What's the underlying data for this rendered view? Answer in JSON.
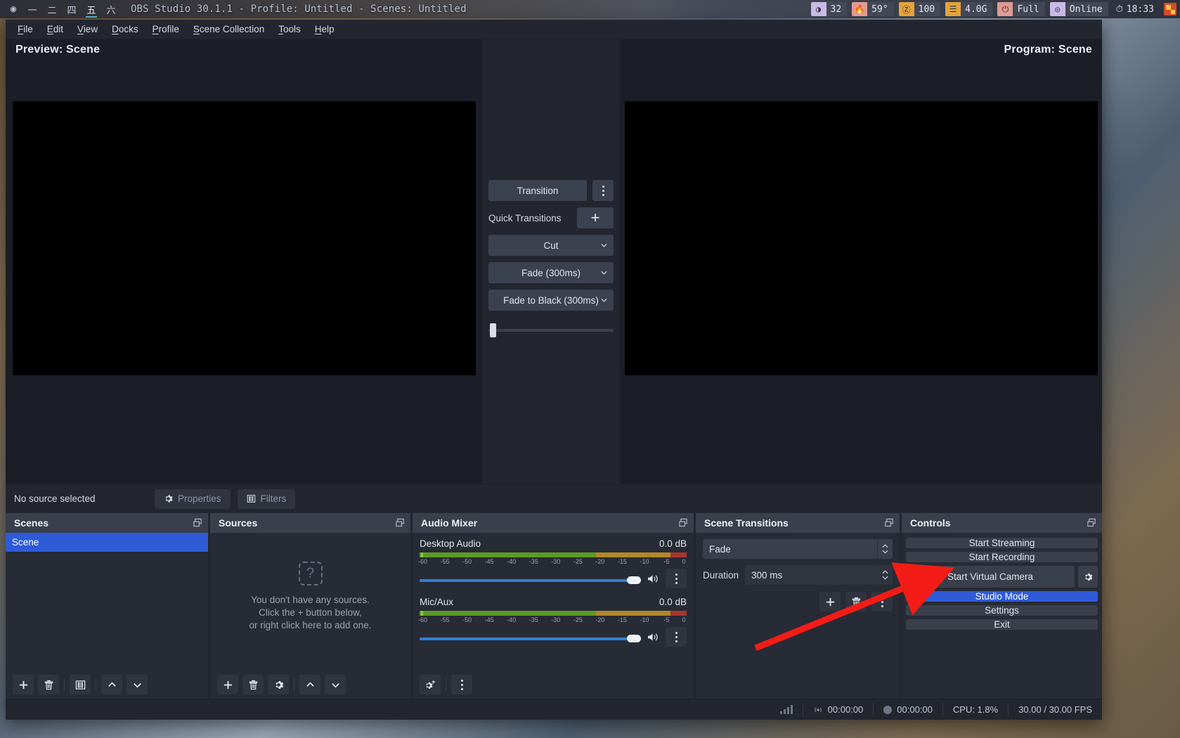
{
  "system_bar": {
    "app_icon": "obs-circle-icon",
    "workspaces": [
      {
        "label": "一",
        "active": false
      },
      {
        "label": "二",
        "active": false
      },
      {
        "label": "四",
        "active": false
      },
      {
        "label": "五",
        "active": true
      },
      {
        "label": "六",
        "active": false
      }
    ],
    "window_title": "OBS Studio 30.1.1 - Profile: Untitled - Scenes: Untitled",
    "indicators": [
      {
        "name": "brightness",
        "icon": "brightness-icon",
        "value": "32",
        "color": "#c9b9e8"
      },
      {
        "name": "temperature",
        "icon": "flame-icon",
        "value": "59°",
        "color": "#e29a92"
      },
      {
        "name": "volume",
        "icon": "headphones-icon",
        "value": "100",
        "color": "#e5a33a"
      },
      {
        "name": "memory",
        "icon": "memory-icon",
        "value": "4.0G",
        "color": "#e5a33a"
      },
      {
        "name": "battery",
        "icon": "plug-icon",
        "value": "Full",
        "color": "#e29a92"
      },
      {
        "name": "network",
        "icon": "wifi-icon",
        "value": "Online",
        "color": "#c9b9e8"
      }
    ],
    "clock_icon": "clock-icon",
    "clock": "18:33"
  },
  "menubar": {
    "items": [
      {
        "pre": "",
        "key": "F",
        "post": "ile"
      },
      {
        "pre": "",
        "key": "E",
        "post": "dit"
      },
      {
        "pre": "",
        "key": "V",
        "post": "iew"
      },
      {
        "pre": "",
        "key": "D",
        "post": "ocks"
      },
      {
        "pre": "",
        "key": "P",
        "post": "rofile"
      },
      {
        "pre": "",
        "key": "S",
        "post": "cene Collection"
      },
      {
        "pre": "",
        "key": "T",
        "post": "ools"
      },
      {
        "pre": "",
        "key": "H",
        "post": "elp"
      }
    ]
  },
  "stage": {
    "preview_label": "Preview: Scene",
    "program_label": "Program: Scene"
  },
  "transitions_column": {
    "transition_button": "Transition",
    "transition_menu_icon": "kebab-menu-icon",
    "quick_transitions_label": "Quick Transitions",
    "add_quick_transition_icon": "plus-icon",
    "quick_items": [
      "Cut",
      "Fade (300ms)",
      "Fade to Black (300ms)"
    ],
    "t_bar_position": "0"
  },
  "source_toolbar": {
    "status": "No source selected",
    "properties_label": "Properties",
    "properties_icon": "gear-icon",
    "filters_label": "Filters",
    "filters_icon": "filters-icon"
  },
  "scenes_dock": {
    "title": "Scenes",
    "float_icon": "undock-icon",
    "items": [
      {
        "label": "Scene",
        "selected": true
      }
    ],
    "toolbar": [
      {
        "name": "add-scene-button",
        "icon": "plus-icon"
      },
      {
        "name": "remove-scene-button",
        "icon": "trash-icon"
      },
      {
        "name": "scene-filters-button",
        "icon": "filters-icon"
      },
      {
        "name": "move-scene-up-button",
        "icon": "chevron-up-icon"
      },
      {
        "name": "move-scene-down-button",
        "icon": "chevron-down-icon"
      }
    ]
  },
  "sources_dock": {
    "title": "Sources",
    "float_icon": "undock-icon",
    "empty_icon": "question-mark-icon",
    "empty_lines": [
      "You don't have any sources.",
      "Click the + button below,",
      "or right click here to add one."
    ],
    "toolbar": [
      {
        "name": "add-source-button",
        "icon": "plus-icon"
      },
      {
        "name": "remove-source-button",
        "icon": "trash-icon"
      },
      {
        "name": "source-properties-button",
        "icon": "gear-icon"
      },
      {
        "name": "move-source-up-button",
        "icon": "chevron-up-icon"
      },
      {
        "name": "move-source-down-button",
        "icon": "chevron-down-icon"
      }
    ]
  },
  "audio_mixer": {
    "title": "Audio Mixer",
    "float_icon": "undock-icon",
    "scale_ticks": [
      "-60",
      "-55",
      "-50",
      "-45",
      "-40",
      "-35",
      "-30",
      "-25",
      "-20",
      "-15",
      "-10",
      "-5",
      "0"
    ],
    "channels": [
      {
        "name": "Desktop Audio",
        "db": "0.0 dB",
        "fader_percent": 97,
        "mute_icon": "speaker-icon",
        "menu_icon": "kebab-menu-icon"
      },
      {
        "name": "Mic/Aux",
        "db": "0.0 dB",
        "fader_percent": 97,
        "mute_icon": "speaker-icon",
        "menu_icon": "kebab-menu-icon"
      }
    ],
    "toolbar": [
      {
        "name": "advanced-audio-properties-button",
        "icon": "gears-icon"
      },
      {
        "name": "audio-mixer-menu-button",
        "icon": "kebab-menu-icon"
      }
    ]
  },
  "scene_transitions": {
    "title": "Scene Transitions",
    "float_icon": "undock-icon",
    "transition_value": "Fade",
    "duration_label": "Duration",
    "duration_value": "300 ms",
    "buttons": [
      {
        "name": "add-transition-button",
        "icon": "plus-icon"
      },
      {
        "name": "remove-transition-button",
        "icon": "trash-icon"
      },
      {
        "name": "transition-properties-button",
        "icon": "kebab-menu-icon"
      }
    ]
  },
  "controls": {
    "title": "Controls",
    "float_icon": "undock-icon",
    "start_streaming": "Start Streaming",
    "start_recording": "Start Recording",
    "start_virtual_camera": "Start Virtual Camera",
    "virtual_camera_config_icon": "gear-icon",
    "studio_mode": "Studio Mode",
    "studio_mode_active": true,
    "settings": "Settings",
    "exit": "Exit"
  },
  "statusbar": {
    "signal_icon": "signal-bars-icon",
    "stream_icon": "broadcast-icon",
    "stream_time": "00:00:00",
    "record_icon": "record-dot-icon",
    "record_time": "00:00:00",
    "cpu": "CPU: 1.8%",
    "fps": "30.00 / 30.00 FPS"
  },
  "annotation": {
    "type": "red-arrow",
    "color": "#f41c16",
    "points_to": "Start Virtual Camera"
  },
  "theme": {
    "accent": "#2f5bd8",
    "panel_bg": "#272b35",
    "dock_header": "#3a3f4c",
    "button_bg": "#3a3f4c",
    "text": "#dfe4ed"
  }
}
